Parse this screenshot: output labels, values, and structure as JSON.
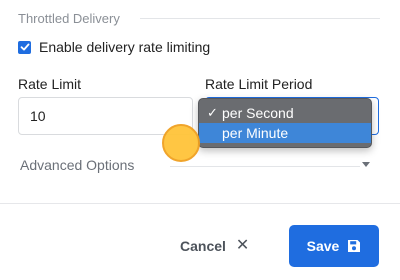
{
  "section": {
    "title": "Throttled Delivery"
  },
  "rate_limiting": {
    "enabled": true,
    "checkbox_label": "Enable delivery rate limiting"
  },
  "rate_limit": {
    "label": "Rate Limit",
    "value": "10"
  },
  "rate_limit_period": {
    "label": "Rate Limit Period",
    "options": [
      {
        "label": "per Second",
        "selected": true,
        "highlighted": false
      },
      {
        "label": "per Minute",
        "selected": false,
        "highlighted": true
      }
    ]
  },
  "advanced": {
    "label": "Advanced Options"
  },
  "footer": {
    "cancel_label": "Cancel",
    "save_label": "Save"
  },
  "colors": {
    "accent": "#1f6de0",
    "menu_background": "#6a6c70",
    "menu_highlight": "#3e86d8",
    "cursor": "#ffc439"
  },
  "icons": {
    "checkbox": "check-icon",
    "selected_option": "checkmark-icon",
    "advanced_toggle": "chevron-down-icon",
    "cancel": "close-icon",
    "save": "floppy-disk-icon"
  }
}
